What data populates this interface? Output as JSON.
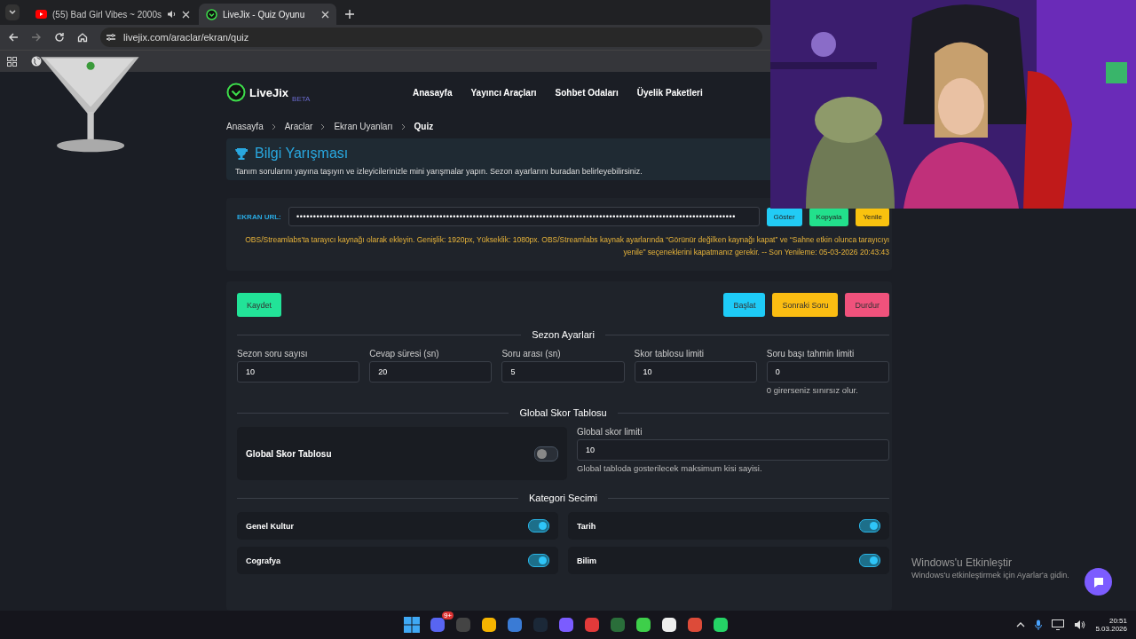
{
  "browser": {
    "tabs": [
      {
        "title": "(55) Bad Girl Vibes ~ 2000s",
        "selected": false,
        "kind": "video"
      },
      {
        "title": "LiveJix - Quiz Oyunu",
        "selected": true,
        "kind": "site"
      }
    ],
    "url": "livejix.com/araclar/ekran/quiz"
  },
  "site": {
    "logo": "LiveJix",
    "logo_badge": "BETA",
    "nav": [
      "Anasayfa",
      "Yayıncı Araçları",
      "Sohbet Odaları",
      "Üyelik Paketleri"
    ]
  },
  "breadcrumb": [
    "Anasayfa",
    "Araclar",
    "Ekran Uyanları",
    "Quiz"
  ],
  "header": {
    "title": "Bilgi Yarışması",
    "description": "Tanım sorularını yayına taşıyın ve izleyicilerinizle mini yarışmalar yapın. Sezon ayarlarını buradan belirleyebilirsiniz."
  },
  "screen_url": {
    "label": "EKRAN URL:",
    "value": "••••••••••••••••••••••••••••••••••••••••••••••••••••••••••••••••••••••••••••••••••••••••••••••••••••••••••••••••••••••••••••••••••••",
    "buttons": [
      {
        "label": "Göster",
        "color": "#22cbf5"
      },
      {
        "label": "Kopyala",
        "color": "#22e08c"
      },
      {
        "label": "Yenile",
        "color": "#f9c20f"
      }
    ],
    "note": "OBS/Streamlabs'ta tarayıcı kaynağı olarak ekleyin. Genişlik: 1920px, Yükseklik: 1080px. OBS/Streamlabs kaynak ayarlarında “Görünür değilken kaynağı kapat” ve “Sahne etkin olunca tarayıcıyı yenile” seçeneklerini kapatmanız gerekir. -- Son Yenileme: 05-03-2026 20:43:43"
  },
  "actions": {
    "left": [
      {
        "label": "Kaydet",
        "color": "#22e398"
      }
    ],
    "right": [
      {
        "label": "Başlat",
        "color": "#1ecbf7"
      },
      {
        "label": "Sonraki Soru",
        "color": "#fbbd12"
      },
      {
        "label": "Durdur",
        "color": "#f0527c"
      }
    ]
  },
  "season": {
    "heading": "Sezon Ayarlari",
    "fields": [
      {
        "label": "Sezon soru sayısı",
        "value": "10"
      },
      {
        "label": "Cevap süresi (sn)",
        "value": "20"
      },
      {
        "label": "Soru arası (sn)",
        "value": "5"
      },
      {
        "label": "Skor tablosu limiti",
        "value": "10"
      },
      {
        "label": "Soru başı tahmin limiti",
        "value": "0",
        "hint": "0 girerseniz sınırsız olur."
      }
    ]
  },
  "global": {
    "heading": "Global Skor Tablosu",
    "toggle_label": "Global Skor Tablosu",
    "on": false,
    "limit_label": "Global skor limiti",
    "limit_value": "10",
    "hint": "Global tabloda gosterilecek maksimum kisi sayisi."
  },
  "categories": {
    "heading": "Kategori Secimi",
    "items": [
      {
        "name": "Genel Kultur",
        "on": true
      },
      {
        "name": "Tarih",
        "on": true
      },
      {
        "name": "Cografya",
        "on": true
      },
      {
        "name": "Bilim",
        "on": true
      }
    ]
  },
  "activation": {
    "title": "Windows'u Etkinleştir",
    "text": "Windows'u etkinleştirmek için Ayarlar'a gidin."
  },
  "taskbar": {
    "badge": "9+",
    "time": "20:51",
    "date": "5.03.2026"
  }
}
